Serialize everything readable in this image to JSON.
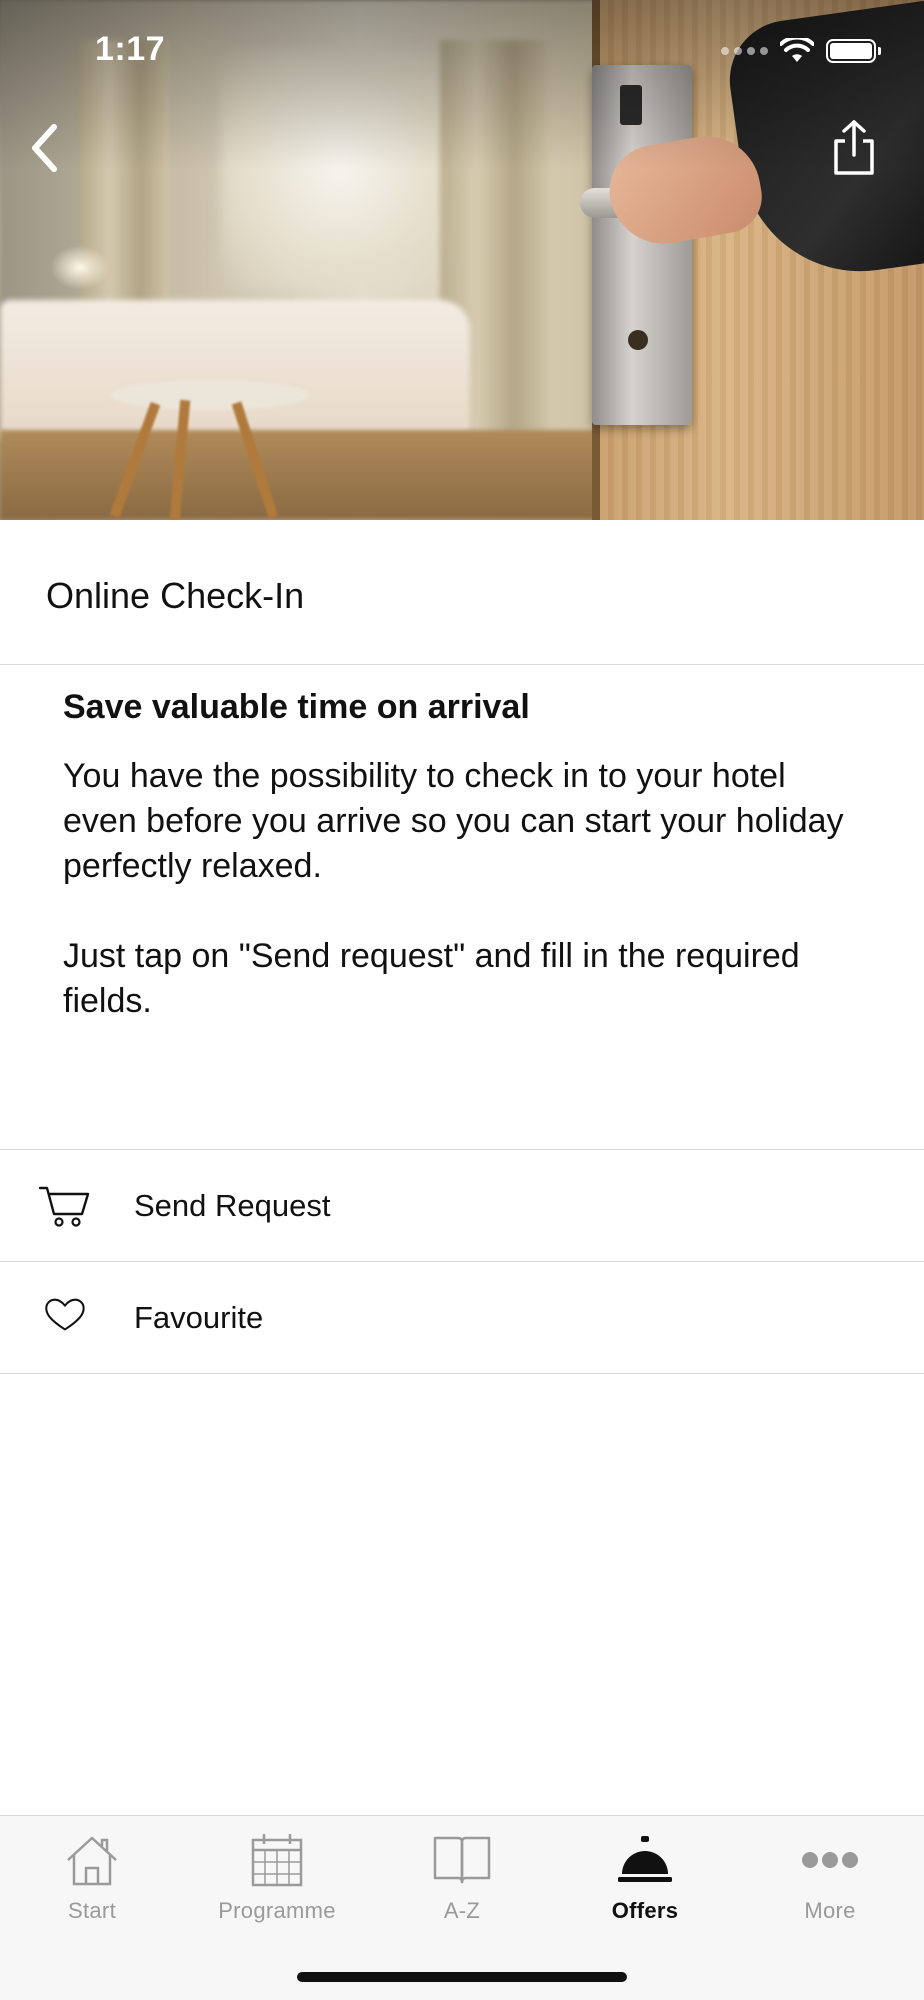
{
  "status_bar": {
    "time": "1:17"
  },
  "hero": {
    "back_icon": "chevron-left-icon",
    "share_icon": "share-icon"
  },
  "page": {
    "title": "Online Check-In"
  },
  "description": {
    "heading": "Save valuable time on arrival",
    "paragraph_1": "You have the possibility to check in to your hotel even before you arrive so you can start your holiday perfectly relaxed.",
    "paragraph_2": "Just tap on \"Send request\" and fill in the required fields."
  },
  "actions": [
    {
      "label": "Send Request",
      "icon": "cart-icon"
    },
    {
      "label": "Favourite",
      "icon": "heart-icon"
    }
  ],
  "tabbar": {
    "tabs": [
      {
        "label": "Start",
        "icon": "house-icon"
      },
      {
        "label": "Programme",
        "icon": "calendar-icon"
      },
      {
        "label": "A-Z",
        "icon": "book-icon"
      },
      {
        "label": "Offers",
        "icon": "service-bell-icon"
      },
      {
        "label": "More",
        "icon": "more-dots-icon"
      }
    ],
    "active": "Offers"
  },
  "colors": {
    "active_tab": "#111111",
    "inactive_tab": "#9a9a9a",
    "divider": "#d9d9d9",
    "tabbar_background": "#f7f7f7"
  }
}
